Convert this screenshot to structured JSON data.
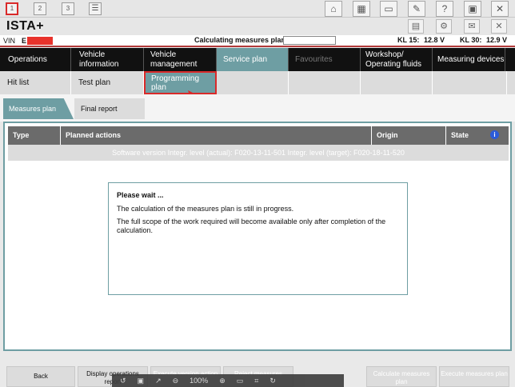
{
  "topbar": {
    "windows": [
      "1",
      "2",
      "3"
    ],
    "icons": [
      "list-icon",
      "home-icon",
      "vehicle-icon",
      "print-icon",
      "wrench-icon",
      "help-icon",
      "screenshot-icon",
      "close-icon"
    ]
  },
  "titlebar": {
    "title": "ISTA+",
    "icons": [
      "connection-icon",
      "gear-icon",
      "mail-icon",
      "close-icon"
    ]
  },
  "vin": {
    "label": "VIN",
    "value": "E",
    "calc_label": "Calculating measures plan",
    "kl15_label": "KL 15:",
    "kl15_value": "12.8 V",
    "kl30_label": "KL 30:",
    "kl30_value": "12.9 V"
  },
  "nav": [
    {
      "label": "Operations"
    },
    {
      "label": "Vehicle information"
    },
    {
      "label": "Vehicle management"
    },
    {
      "label": "Service plan"
    },
    {
      "label": "Favourites"
    },
    {
      "label": "Workshop/ Operating fluids"
    },
    {
      "label": "Measuring devices"
    }
  ],
  "subnav": [
    {
      "label": "Hit list"
    },
    {
      "label": "Test plan"
    },
    {
      "label": "Programming plan"
    }
  ],
  "tabs": [
    {
      "label": "Measures plan"
    },
    {
      "label": "Final report"
    }
  ],
  "table": {
    "headers": [
      "Type",
      "Planned actions",
      "Origin",
      "State"
    ],
    "sw_row": "Software version   Integr. level (actual): F020-13-11-501     Integr. level (target): F020-18-11-520"
  },
  "dialog": {
    "heading": "Please wait ...",
    "line1": "The calculation of the measures plan is still in progress.",
    "line2": "The full scope of the work required will become available only after completion of the calculation."
  },
  "bottom": {
    "back": "Back",
    "display_ops": "Display operations report",
    "execute_version": "Execute version action",
    "reject_measures": "Reject measures",
    "calculate_plan": "Calculate measures plan",
    "execute_plan": "Execute measures plan",
    "zoom": "100%"
  },
  "colors": {
    "accent": "#6e9ea3",
    "highlight": "#d92a2a",
    "nav_bg": "#111111"
  }
}
